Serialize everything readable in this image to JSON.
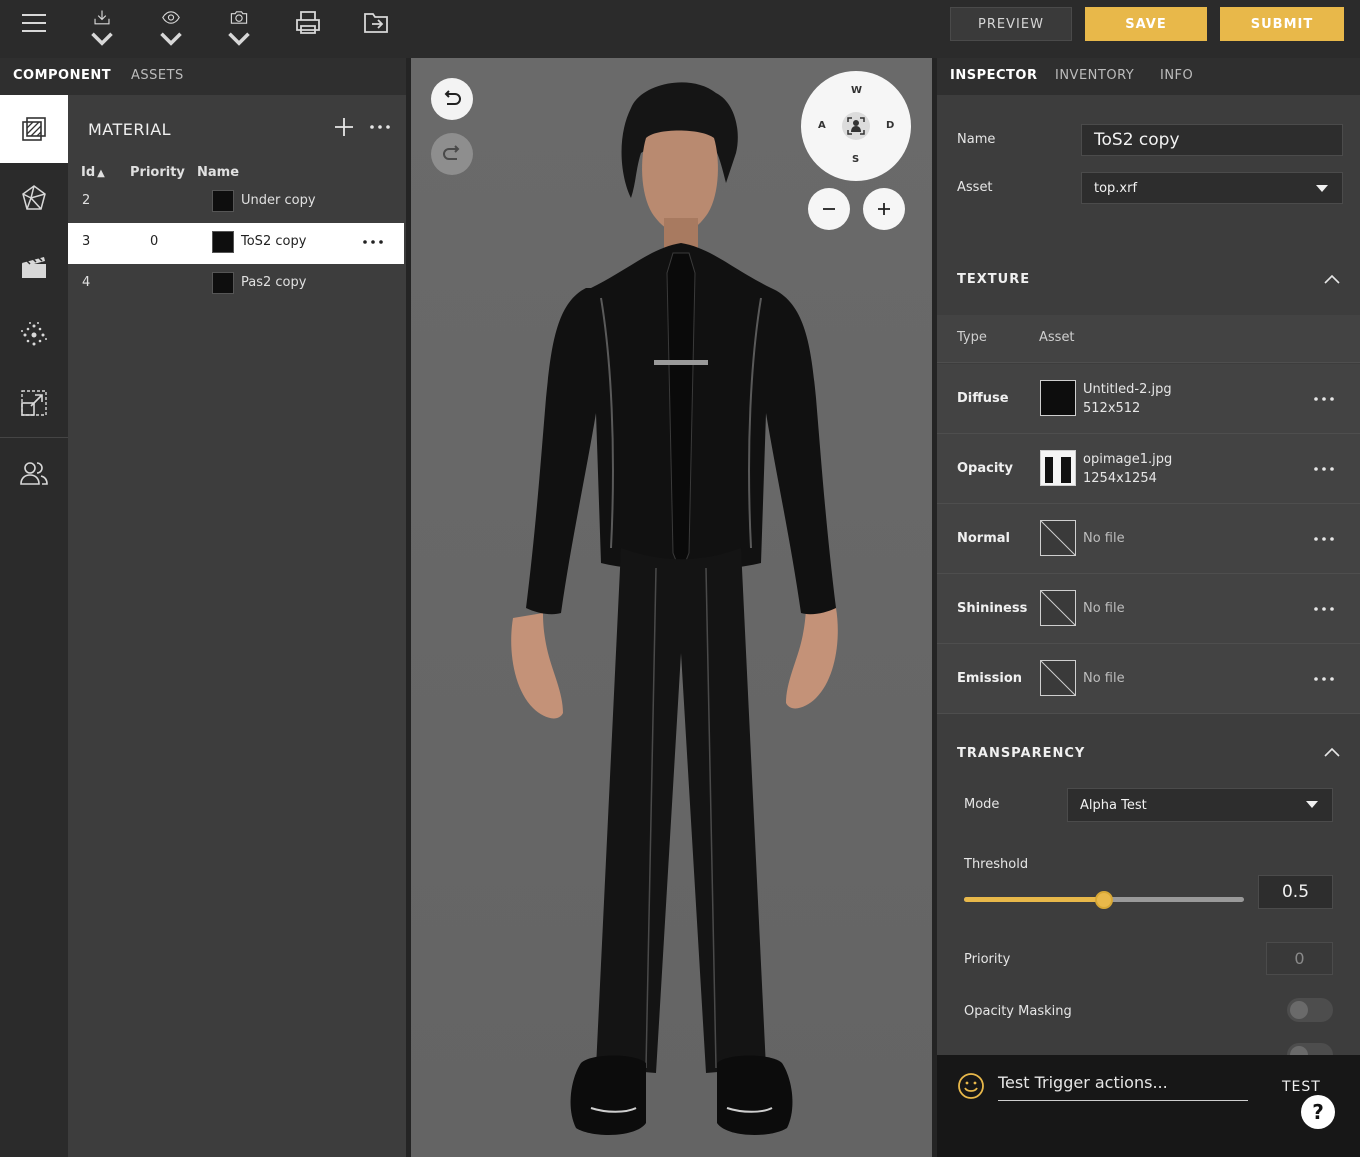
{
  "toolbar": {
    "icons": [
      "menu-icon",
      "download-icon",
      "eye-icon",
      "camera-icon",
      "printer-icon",
      "export-icon"
    ],
    "preview_label": "PREVIEW",
    "save_label": "SAVE",
    "submit_label": "SUBMIT",
    "accent_color": "#e8b84a"
  },
  "left_tabs": {
    "component": "COMPONENT",
    "assets": "ASSETS"
  },
  "rail": {
    "icons": [
      "material-icon",
      "mesh-icon",
      "animation-clapper-icon",
      "particles-icon",
      "resize-icon",
      "users-icon"
    ]
  },
  "material": {
    "title": "MATERIAL",
    "columns": {
      "id": "Id",
      "priority": "Priority",
      "name": "Name"
    },
    "rows": [
      {
        "id": "2",
        "priority": "",
        "name": "Under copy"
      },
      {
        "id": "3",
        "priority": "0",
        "name": "ToS2 copy"
      },
      {
        "id": "4",
        "priority": "",
        "name": "Pas2 copy"
      }
    ]
  },
  "viewport": {
    "compass": {
      "w": "W",
      "a": "A",
      "s": "S",
      "d": "D"
    }
  },
  "right_tabs": {
    "inspector": "INSPECTOR",
    "inventory": "INVENTORY",
    "info": "INFO"
  },
  "inspector": {
    "name_label": "Name",
    "name_value": "ToS2 copy",
    "asset_label": "Asset",
    "asset_value": "top.xrf",
    "texture": {
      "title": "TEXTURE",
      "type_header": "Type",
      "asset_header": "Asset",
      "rows": [
        {
          "type": "Diffuse",
          "file": "Untitled-2.jpg",
          "size": "512x512"
        },
        {
          "type": "Opacity",
          "file": "opimage1.jpg",
          "size": "1254x1254"
        },
        {
          "type": "Normal",
          "file": "No file",
          "size": ""
        },
        {
          "type": "Shininess",
          "file": "No file",
          "size": ""
        },
        {
          "type": "Emission",
          "file": "No file",
          "size": ""
        }
      ]
    },
    "transparency": {
      "title": "TRANSPARENCY",
      "mode_label": "Mode",
      "mode_value": "Alpha Test",
      "threshold_label": "Threshold",
      "threshold_value": "0.5",
      "threshold_fraction": 0.5,
      "priority_label": "Priority",
      "priority_value": "0",
      "opacity_masking_label": "Opacity Masking",
      "opacity_masking_on": false
    }
  },
  "trigger": {
    "placeholder": "Test Trigger actions...",
    "test_label": "TEST",
    "help_label": "?"
  }
}
